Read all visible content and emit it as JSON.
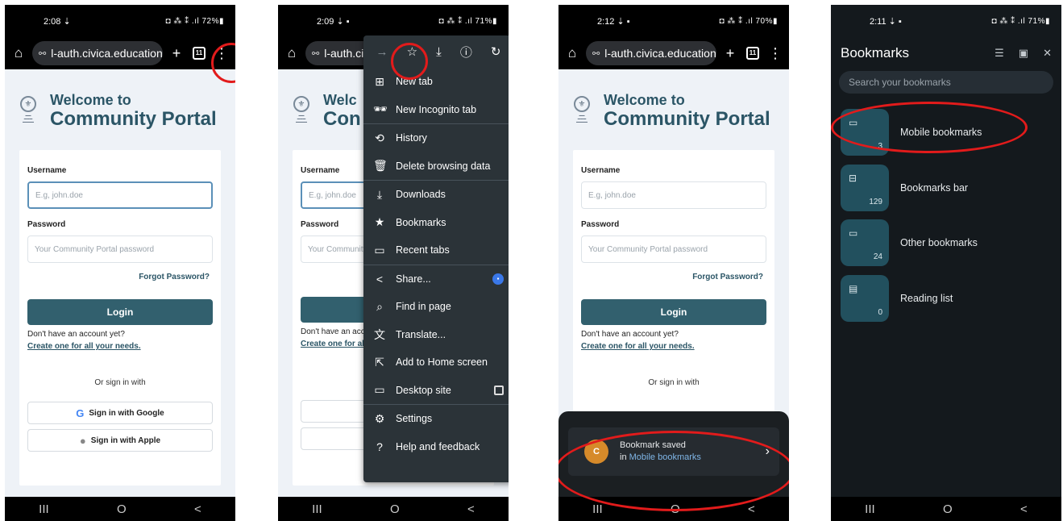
{
  "panel1": {
    "status": {
      "time": "2:08 ⇣",
      "icons": "◘ ⁂ ⁑ .ıl 72%▮"
    },
    "url": "l-auth.civica.education",
    "tab_count": "11",
    "title_line1": "Welcome to",
    "title_line2": "Community Portal",
    "username_label": "Username",
    "username_placeholder": "E.g, john.doe",
    "password_label": "Password",
    "password_placeholder": "Your Community Portal password",
    "forgot": "Forgot Password?",
    "login": "Login",
    "no_account": "Don't have an account yet?",
    "create": "Create one for all your needs.",
    "or_sign_in": "Or sign in with",
    "google": "Sign in with Google",
    "apple": "Sign in with Apple"
  },
  "panel2": {
    "status": {
      "time": "2:09 ⇣ ▪",
      "icons": "◘ ⁂ ⁑ .ıl 71%▮"
    },
    "url": "l-auth.civ",
    "welcome_partial": "Welc",
    "portal_partial": "Con",
    "username_label": "Username",
    "username_placeholder": "E.g, john.doe",
    "password_label": "Password",
    "password_placeholder": "Your Community",
    "no_account": "Don't have an accou",
    "create": "Create one for all",
    "menu_items": [
      {
        "icon": "⊞",
        "label": "New tab"
      },
      {
        "icon": "🕶",
        "label": "New Incognito tab"
      },
      {
        "icon": "⟲",
        "label": "History"
      },
      {
        "icon": "🗑",
        "label": "Delete browsing data"
      },
      {
        "icon": "⤓",
        "label": "Downloads"
      },
      {
        "icon": "★",
        "label": "Bookmarks"
      },
      {
        "icon": "▭",
        "label": "Recent tabs"
      },
      {
        "icon": "<",
        "label": "Share..."
      },
      {
        "icon": "⌕",
        "label": "Find in page"
      },
      {
        "icon": "文",
        "label": "Translate..."
      },
      {
        "icon": "⇱",
        "label": "Add to Home screen"
      },
      {
        "icon": "▭",
        "label": "Desktop site"
      },
      {
        "icon": "⚙",
        "label": "Settings"
      },
      {
        "icon": "?",
        "label": "Help and feedback"
      }
    ]
  },
  "panel3": {
    "status": {
      "time": "2:12 ⇣ ▪",
      "icons": "◘ ⁂ ⁑ .ıl 70%▮"
    },
    "url": "l-auth.civica.education",
    "tab_count": "11",
    "snack_line1": "Bookmark saved",
    "snack_prefix": "in ",
    "snack_link": "Mobile bookmarks",
    "fav_letter": "C"
  },
  "panel4": {
    "status": {
      "time": "2:11 ⇣ ▪",
      "icons": "◘ ⁂ ⁑ .ıl 71%▮"
    },
    "title": "Bookmarks",
    "search_placeholder": "Search your bookmarks",
    "folders": [
      {
        "label": "Mobile bookmarks",
        "count": "3",
        "icon": "▭"
      },
      {
        "label": "Bookmarks bar",
        "count": "129",
        "icon": "⊟"
      },
      {
        "label": "Other bookmarks",
        "count": "24",
        "icon": "▭"
      },
      {
        "label": "Reading list",
        "count": "0",
        "icon": "▤"
      }
    ]
  },
  "nav": {
    "recents": "III",
    "home": "O",
    "back": "<"
  },
  "accent_color": "#e21b1b"
}
